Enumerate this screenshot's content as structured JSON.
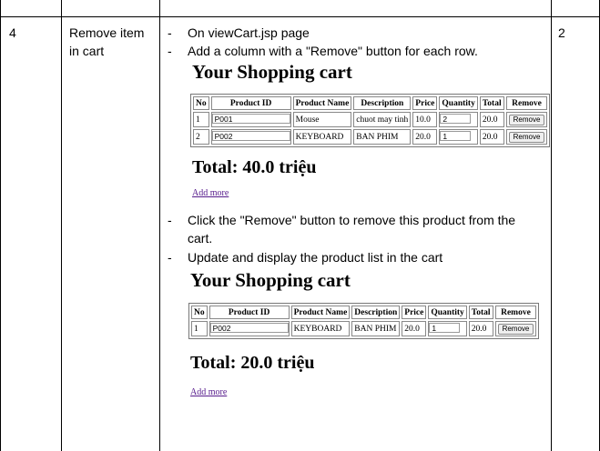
{
  "row": {
    "number": "4",
    "feature": "Remove item in cart",
    "points": "2"
  },
  "steps_top": [
    "On viewCart.jsp page",
    "Add a column with a \"Remove\" button for each row."
  ],
  "steps_bottom": [
    "Click the \"Remove\" button to remove this product from the cart.",
    "Update and display the product list in the cart"
  ],
  "cart1": {
    "title": "Your Shopping cart",
    "headers": [
      "No",
      "Product ID",
      "Product Name",
      "Description",
      "Price",
      "Quantity",
      "Total",
      "Remove"
    ],
    "rows": [
      {
        "no": "1",
        "id": "P001",
        "name": "Mouse",
        "desc": "chuot may tinh",
        "price": "10.0",
        "qty": "2",
        "total": "20.0",
        "btn": "Remove"
      },
      {
        "no": "2",
        "id": "P002",
        "name": "KEYBOARD",
        "desc": "BAN PHIM",
        "price": "20.0",
        "qty": "1",
        "total": "20.0",
        "btn": "Remove"
      }
    ],
    "total": "Total: 40.0 triệu",
    "add_more": "Add more"
  },
  "cart2": {
    "title": "Your Shopping cart",
    "headers": [
      "No",
      "Product ID",
      "Product Name",
      "Description",
      "Price",
      "Quantity",
      "Total",
      "Remove"
    ],
    "rows": [
      {
        "no": "1",
        "id": "P002",
        "name": "KEYBOARD",
        "desc": "BAN PHIM",
        "price": "20.0",
        "qty": "1",
        "total": "20.0",
        "btn": "Remove"
      }
    ],
    "total": "Total: 20.0 triệu",
    "add_more": "Add more"
  }
}
